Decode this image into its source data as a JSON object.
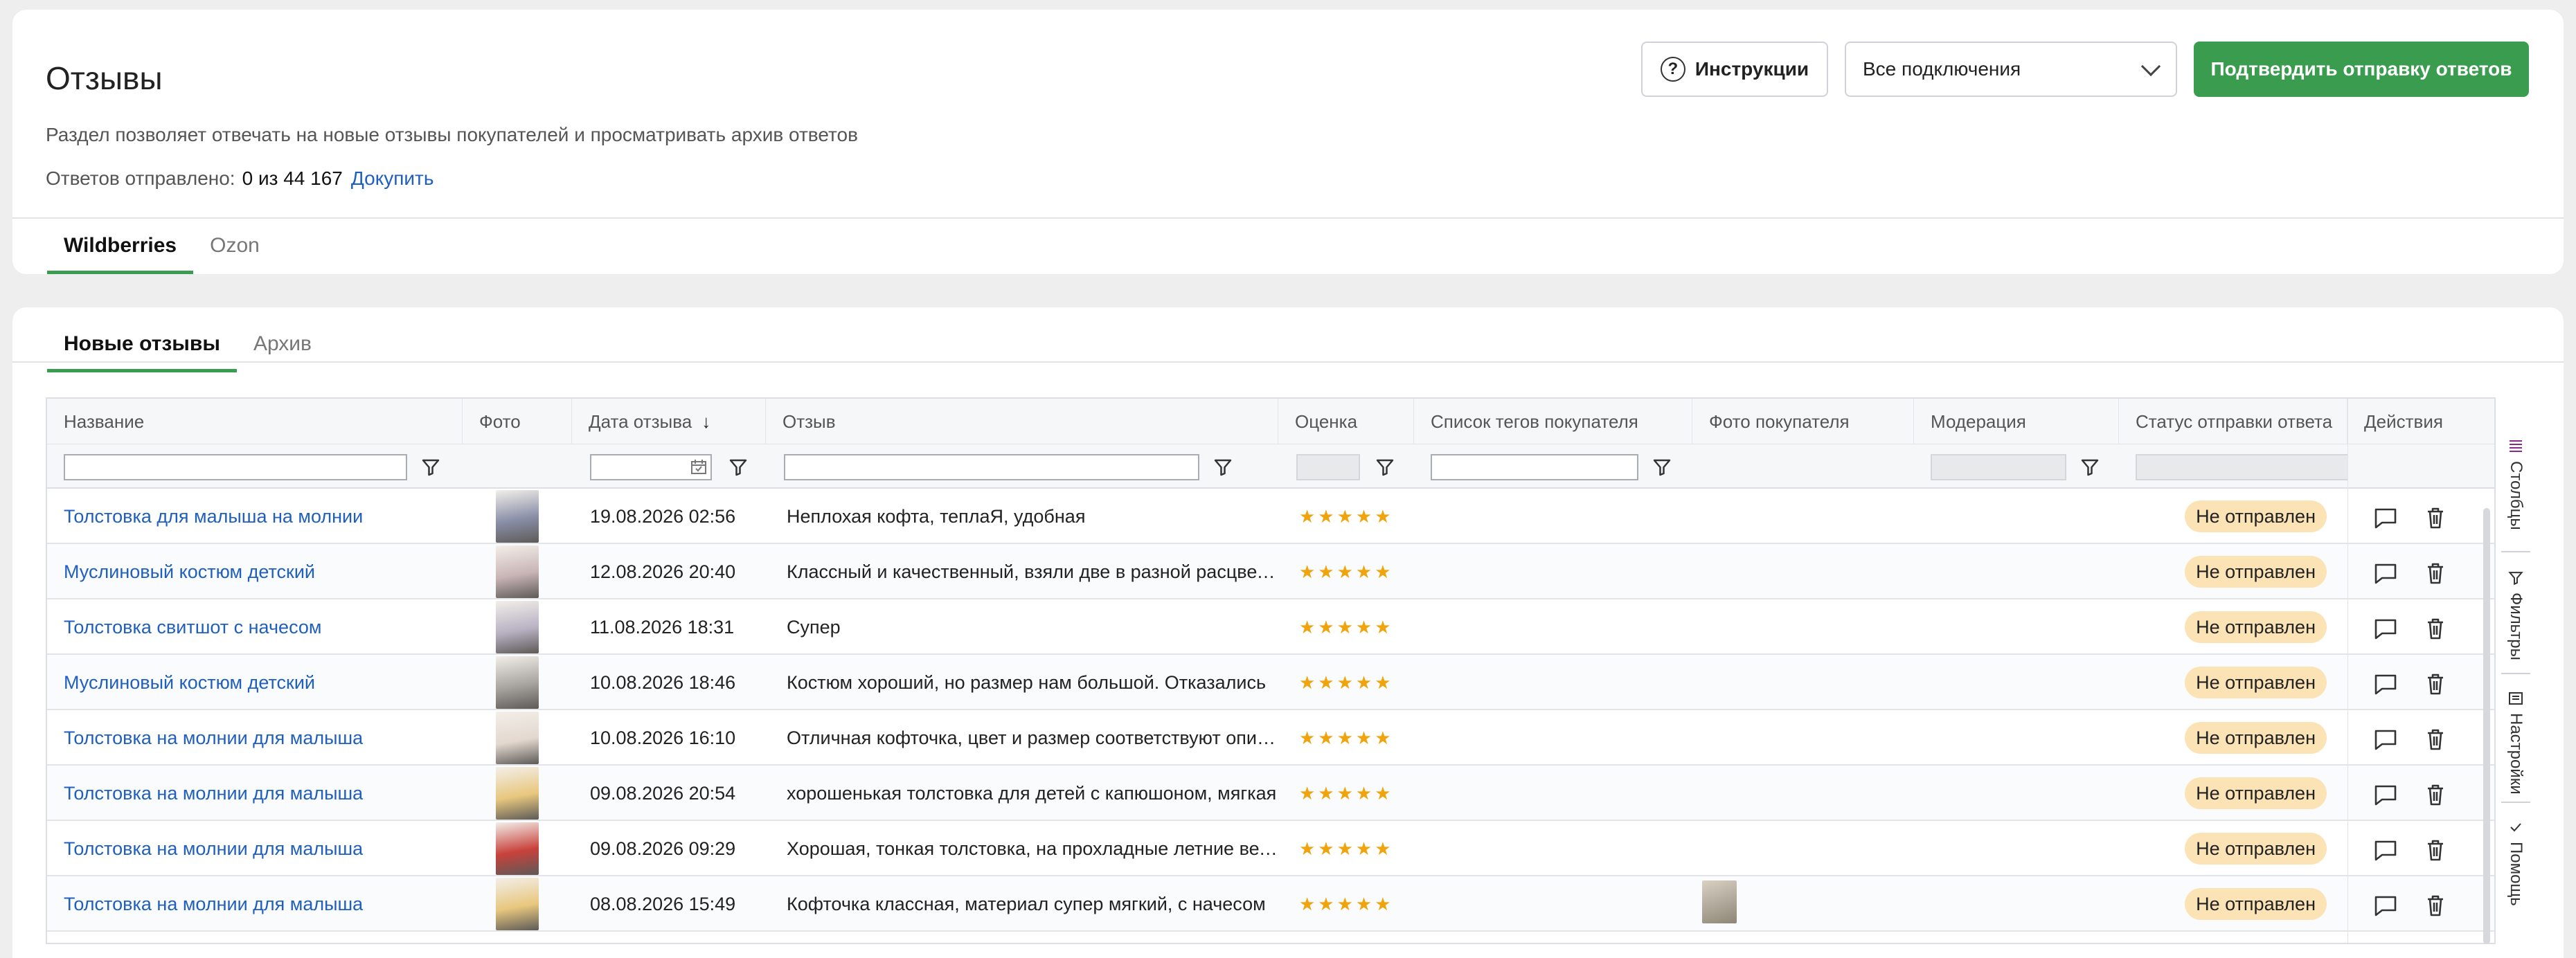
{
  "header": {
    "title": "Отзывы",
    "description": "Раздел позволяет отвечать на новые отзывы покупателей и просматривать архив ответов",
    "sent_label": "Ответов отправлено:",
    "sent_count": "0 из 44 167",
    "buy_more": "Докупить",
    "instructions_button": "Инструкции",
    "connections_select": "Все подключения",
    "confirm_button": "Подтвердить отправку ответов"
  },
  "marketplace_tabs": [
    {
      "label": "Wildberries",
      "active": true
    },
    {
      "label": "Ozon",
      "active": false
    }
  ],
  "review_tabs": [
    {
      "label": "Новые отзывы",
      "active": true
    },
    {
      "label": "Архив",
      "active": false
    }
  ],
  "columns": {
    "name": "Название",
    "photo": "Фото",
    "date": "Дата отзыва",
    "review": "Отзыв",
    "rating": "Оценка",
    "tags": "Список тегов покупателя",
    "buyer_photo": "Фото покупателя",
    "moderation": "Модерация",
    "status": "Статус отправки ответа",
    "actions": "Действия"
  },
  "rows": [
    {
      "name": "Толстовка для малыша на молнии",
      "date": "19.08.2026 02:56",
      "review": "Неплохая кофта, теплаЯ, удобная",
      "rating": 5,
      "stars": "★★★★★",
      "status": "Не отправлен",
      "photo_color": "#8a8fa8"
    },
    {
      "name": "Муслиновый костюм детский",
      "date": "12.08.2026 20:40",
      "review": "Классный и качественный, взяли две в разной расцветке",
      "rating": 5,
      "stars": "★★★★★",
      "status": "Не отправлен",
      "photo_color": "#c9b4b6"
    },
    {
      "name": "Толстовка свитшот с начесом",
      "date": "11.08.2026 18:31",
      "review": "Супер",
      "rating": 5,
      "stars": "★★★★★",
      "status": "Не отправлен",
      "photo_color": "#b9b2c4"
    },
    {
      "name": "Муслиновый костюм детский",
      "date": "10.08.2026 18:46",
      "review": "Костюм хороший, но размер нам большой. Отказались",
      "rating": 5,
      "stars": "★★★★★",
      "status": "Не отправлен",
      "photo_color": "#a8a4a0"
    },
    {
      "name": "Толстовка на молнии для малыша",
      "date": "10.08.2026 16:10",
      "review": "Отличная кофточка, цвет и размер соответствуют описанию",
      "rating": 5,
      "stars": "★★★★★",
      "status": "Не отправлен",
      "photo_color": "#e3d8cf"
    },
    {
      "name": "Толстовка на молнии для малыша",
      "date": "09.08.2026 20:54",
      "review": "хорошенькая толстовка для детей с капюшоном, мягкая",
      "rating": 5,
      "stars": "★★★★★",
      "status": "Не отправлен",
      "photo_color": "#e8c77e"
    },
    {
      "name": "Толстовка на молнии для малыша",
      "date": "09.08.2026 09:29",
      "review": "Хорошая, тонкая толстовка, на прохладные летние вечера",
      "rating": 5,
      "stars": "★★★★★",
      "status": "Не отправлен",
      "photo_color": "#c9413b"
    },
    {
      "name": "Толстовка на молнии для малыша",
      "date": "08.08.2026 15:49",
      "review": "Кофточка классная, материал супер мягкий, с начесом",
      "rating": 5,
      "stars": "★★★★★",
      "status": "Не отправлен",
      "photo_color": "#e8c77e",
      "buyer_photo": true
    }
  ],
  "side_panel": {
    "columns": "Столбцы",
    "filters": "Фильтры",
    "settings": "Настройки",
    "help": "Помощь"
  },
  "colors": {
    "accent_green": "#3a9c4f",
    "link_blue": "#1f5fbf",
    "star_orange": "#f0a30a",
    "badge_bg": "#fbe3b5"
  }
}
